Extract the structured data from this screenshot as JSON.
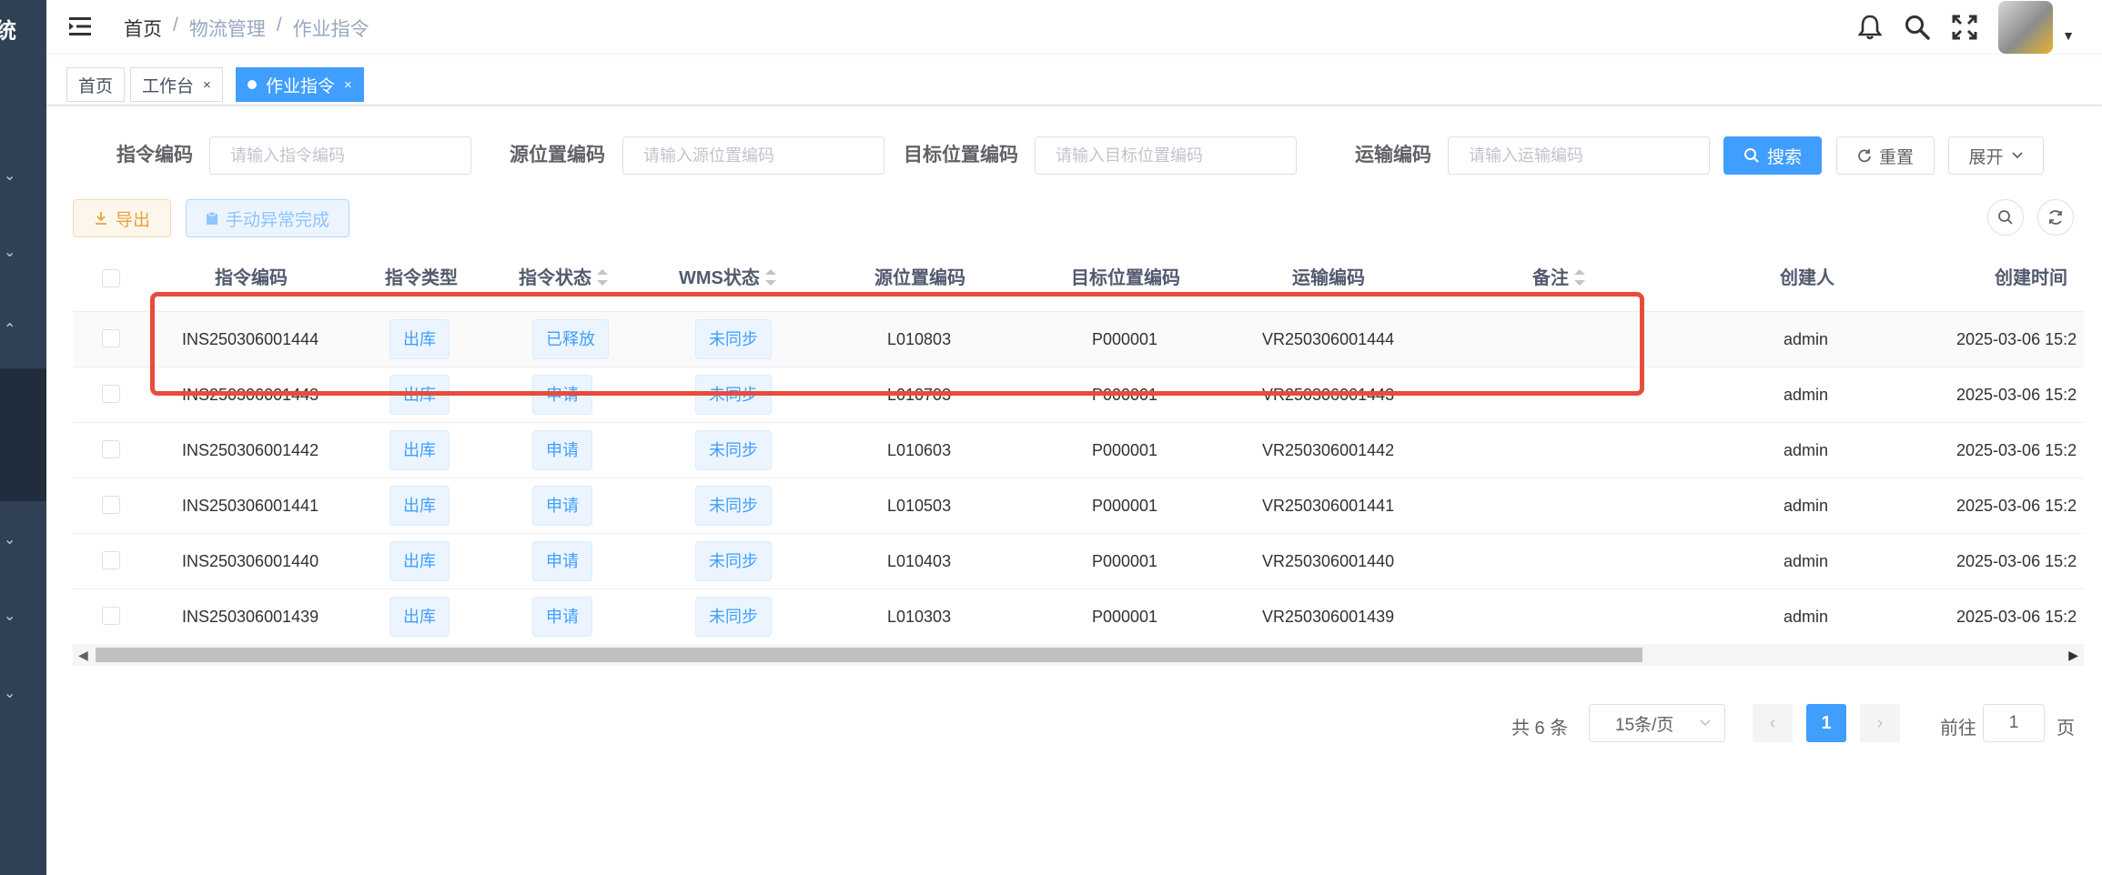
{
  "sidebar": {
    "title_fragment": "统"
  },
  "header": {
    "breadcrumb": [
      "首页",
      "/",
      "物流管理",
      "/",
      "作业指令"
    ]
  },
  "tags": [
    {
      "label": "首页"
    },
    {
      "label": "工作台",
      "close": "×"
    },
    {
      "label": "作业指令",
      "close": "×"
    }
  ],
  "search": {
    "fields": [
      {
        "label": "指令编码",
        "placeholder": "请输入指令编码"
      },
      {
        "label": "源位置编码",
        "placeholder": "请输入源位置编码"
      },
      {
        "label": "目标位置编码",
        "placeholder": "请输入目标位置编码"
      },
      {
        "label": "运输编码",
        "placeholder": "请输入运输编码"
      }
    ],
    "search_btn": "搜索",
    "reset_btn": "重置",
    "expand_btn": "展开"
  },
  "toolbar": {
    "export_btn": "导出",
    "manual_btn": "手动异常完成"
  },
  "table": {
    "columns": [
      "指令编码",
      "指令类型",
      "指令状态",
      "WMS状态",
      "源位置编码",
      "目标位置编码",
      "运输编码",
      "备注",
      "创建人",
      "创建时间"
    ],
    "rows": [
      {
        "code": "INS250306001444",
        "type": "出库",
        "status": "已释放",
        "wms": "未同步",
        "src": "L010803",
        "dst": "P000001",
        "transport": "VR250306001444",
        "remark": "",
        "creator": "admin",
        "time": "2025-03-06 15:2"
      },
      {
        "code": "INS250306001443",
        "type": "出库",
        "status": "申请",
        "wms": "未同步",
        "src": "L010703",
        "dst": "P000001",
        "transport": "VR250306001443",
        "remark": "",
        "creator": "admin",
        "time": "2025-03-06 15:2"
      },
      {
        "code": "INS250306001442",
        "type": "出库",
        "status": "申请",
        "wms": "未同步",
        "src": "L010603",
        "dst": "P000001",
        "transport": "VR250306001442",
        "remark": "",
        "creator": "admin",
        "time": "2025-03-06 15:2"
      },
      {
        "code": "INS250306001441",
        "type": "出库",
        "status": "申请",
        "wms": "未同步",
        "src": "L010503",
        "dst": "P000001",
        "transport": "VR250306001441",
        "remark": "",
        "creator": "admin",
        "time": "2025-03-06 15:2"
      },
      {
        "code": "INS250306001440",
        "type": "出库",
        "status": "申请",
        "wms": "未同步",
        "src": "L010403",
        "dst": "P000001",
        "transport": "VR250306001440",
        "remark": "",
        "creator": "admin",
        "time": "2025-03-06 15:2"
      },
      {
        "code": "INS250306001439",
        "type": "出库",
        "status": "申请",
        "wms": "未同步",
        "src": "L010303",
        "dst": "P000001",
        "transport": "VR250306001439",
        "remark": "",
        "creator": "admin",
        "time": "2025-03-06 15:2"
      }
    ]
  },
  "pagination": {
    "total_text": "共 6 条",
    "page_size": "15条/页",
    "current_page": "1",
    "goto_label": "前往",
    "goto_value": "1",
    "page_suffix": "页"
  },
  "colors": {
    "accent": "#409eff",
    "sidebar": "#304156",
    "highlight": "#e74c3c"
  }
}
